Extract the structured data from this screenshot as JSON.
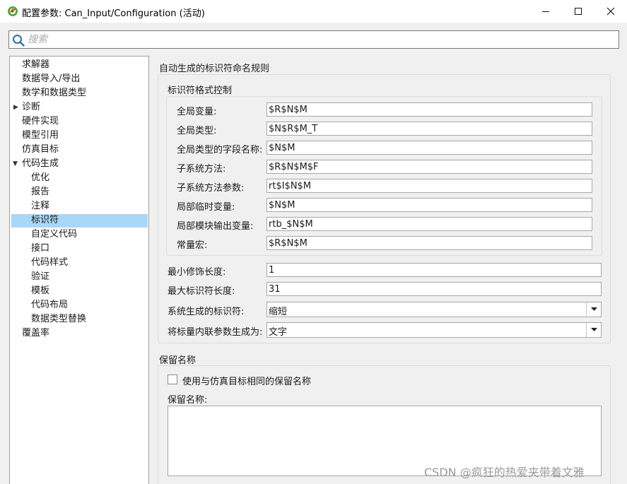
{
  "window": {
    "title": "配置参数: Can_Input/Configuration (活动)",
    "icon": "simulink-logo-icon",
    "controls": [
      "minimize-icon",
      "maximize-icon",
      "close-icon"
    ]
  },
  "search": {
    "placeholder": "搜索",
    "value": ""
  },
  "tree": {
    "items": [
      {
        "label": "求解器",
        "level": 0,
        "expandable": false
      },
      {
        "label": "数据导入/导出",
        "level": 0,
        "expandable": false
      },
      {
        "label": "数学和数据类型",
        "level": 0,
        "expandable": false
      },
      {
        "label": "诊断",
        "level": 0,
        "expandable": true,
        "expanded": false
      },
      {
        "label": "硬件实现",
        "level": 0,
        "expandable": false
      },
      {
        "label": "模型引用",
        "level": 0,
        "expandable": false
      },
      {
        "label": "仿真目标",
        "level": 0,
        "expandable": false
      },
      {
        "label": "代码生成",
        "level": 0,
        "expandable": true,
        "expanded": true
      },
      {
        "label": "优化",
        "level": 1
      },
      {
        "label": "报告",
        "level": 1
      },
      {
        "label": "注释",
        "level": 1
      },
      {
        "label": "标识符",
        "level": 1,
        "selected": true
      },
      {
        "label": "自定义代码",
        "level": 1
      },
      {
        "label": "接口",
        "level": 1
      },
      {
        "label": "代码样式",
        "level": 1
      },
      {
        "label": "验证",
        "level": 1
      },
      {
        "label": "模板",
        "level": 1
      },
      {
        "label": "代码布局",
        "level": 1
      },
      {
        "label": "数据类型替换",
        "level": 1
      },
      {
        "label": "覆盖率",
        "level": 0,
        "expandable": false
      }
    ]
  },
  "identifier_rules": {
    "title": "自动生成的标识符命名规则",
    "format_control": {
      "title": "标识符格式控制",
      "fields": [
        {
          "label": "全局变量:",
          "value": "$R$N$M"
        },
        {
          "label": "全局类型:",
          "value": "$N$R$M_T"
        },
        {
          "label": "全局类型的字段名称:",
          "value": "$N$M"
        },
        {
          "label": "子系统方法:",
          "value": "$R$N$M$F"
        },
        {
          "label": "子系统方法参数:",
          "value": "rt$I$N$M"
        },
        {
          "label": "局部临时变量:",
          "value": "$N$M"
        },
        {
          "label": "局部模块输出变量:",
          "value": "rtb_$N$M"
        },
        {
          "label": "常量宏:",
          "value": "$R$N$M"
        }
      ]
    },
    "min_mangle_length": {
      "label": "最小修饰长度:",
      "value": "1"
    },
    "max_identifier_length": {
      "label": "最大标识符长度:",
      "value": "31"
    },
    "system_generated_identifiers": {
      "label": "系统生成的标识符:",
      "value": "缩短"
    },
    "inline_scalar_params": {
      "label": "将标量内联参数生成为:",
      "value": "文字"
    }
  },
  "reserved_names": {
    "title": "保留名称",
    "checkbox_label": "使用与仿真目标相同的保留名称",
    "checked": false,
    "textarea_label": "保留名称:",
    "textarea_value": ""
  },
  "watermark": "CSDN @疯狂的热爱夹带着文雅"
}
